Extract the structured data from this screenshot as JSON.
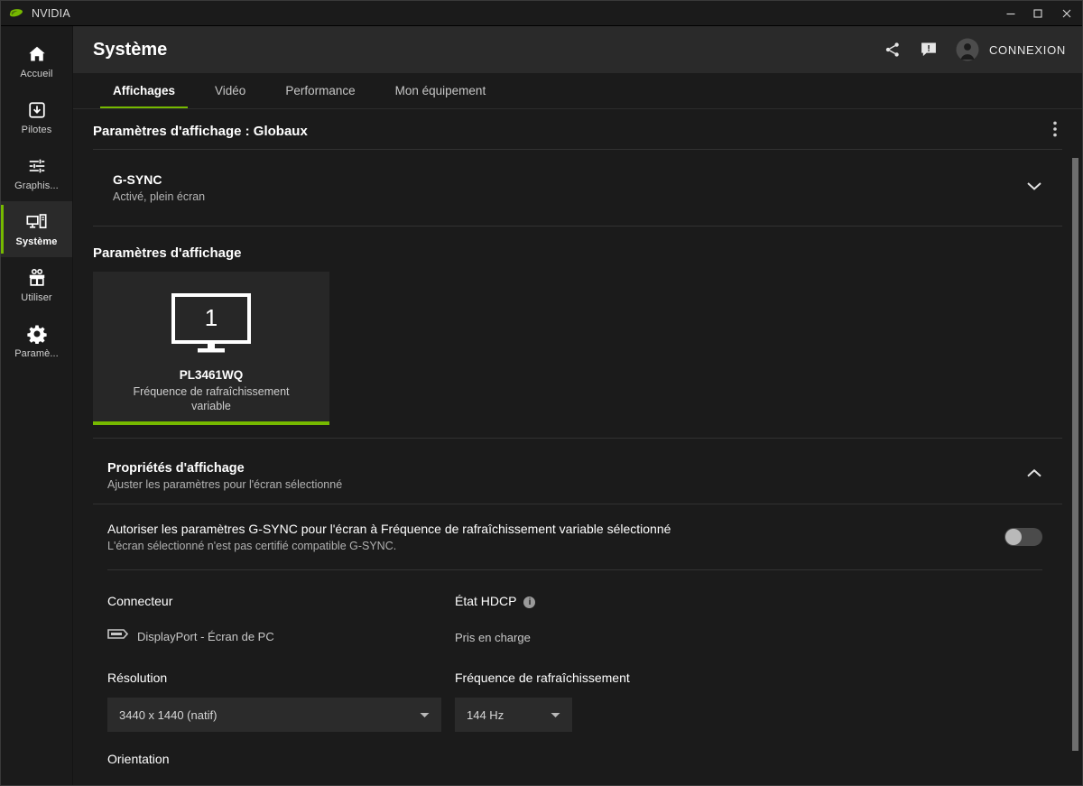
{
  "window": {
    "app_name": "NVIDIA",
    "logo_icon": "nvidia-eye-logo",
    "minimize_icon": "minimize-icon",
    "maximize_icon": "maximize-icon",
    "close_icon": "close-icon"
  },
  "sidebar": {
    "items": [
      {
        "label": "Accueil",
        "icon": "home-icon",
        "active": false
      },
      {
        "label": "Pilotes",
        "icon": "download-icon",
        "active": false
      },
      {
        "label": "Graphis...",
        "icon": "sliders-icon",
        "active": false
      },
      {
        "label": "Système",
        "icon": "system-icon",
        "active": true
      },
      {
        "label": "Utiliser",
        "icon": "gift-icon",
        "active": false
      },
      {
        "label": "Paramè...",
        "icon": "gear-icon",
        "active": false
      }
    ]
  },
  "header": {
    "title": "Système",
    "share_icon": "share-icon",
    "feedback_icon": "feedback-icon",
    "avatar_icon": "avatar-icon",
    "login_label": "CONNEXION"
  },
  "tabs": [
    {
      "label": "Affichages",
      "active": true
    },
    {
      "label": "Vidéo",
      "active": false
    },
    {
      "label": "Performance",
      "active": false
    },
    {
      "label": "Mon équipement",
      "active": false
    }
  ],
  "global_settings": {
    "section_title": "Paramètres d'affichage : Globaux",
    "kebab_icon": "more-vertical-icon",
    "gsync": {
      "label": "G-SYNC",
      "value": "Activé, plein écran",
      "chevron_icon": "chevron-down-icon"
    }
  },
  "display_settings": {
    "block_title": "Paramètres d'affichage",
    "monitor": {
      "number": "1",
      "name": "PL3461WQ",
      "subtitle": "Fréquence de rafraîchissement variable",
      "accent_color": "#76b900",
      "monitor_icon": "monitor-icon"
    }
  },
  "display_properties": {
    "title": "Propriétés d'affichage",
    "subtitle": "Ajuster les paramètres pour l'écran sélectionné",
    "collapse_icon": "chevron-up-icon",
    "gsync_toggle": {
      "label": "Autoriser les paramètres G-SYNC pour l'écran à Fréquence de rafraîchissement variable sélectionné",
      "note": "L'écran sélectionné n'est pas certifié compatible G-SYNC.",
      "state": "off"
    },
    "connector": {
      "label": "Connecteur",
      "icon": "displayport-icon",
      "value": "DisplayPort - Écran de PC"
    },
    "hdcp": {
      "label": "État HDCP",
      "info_icon": "info-icon",
      "info_glyph": "i",
      "value": "Pris en charge"
    },
    "resolution": {
      "label": "Résolution",
      "value": "3440 x 1440 (natif)",
      "caret_icon": "caret-down-icon"
    },
    "refresh_rate": {
      "label": "Fréquence de rafraîchissement",
      "value": "144 Hz",
      "caret_icon": "caret-down-icon"
    },
    "orientation": {
      "label": "Orientation"
    }
  },
  "scrollbar": {
    "name": "content-scrollbar"
  }
}
